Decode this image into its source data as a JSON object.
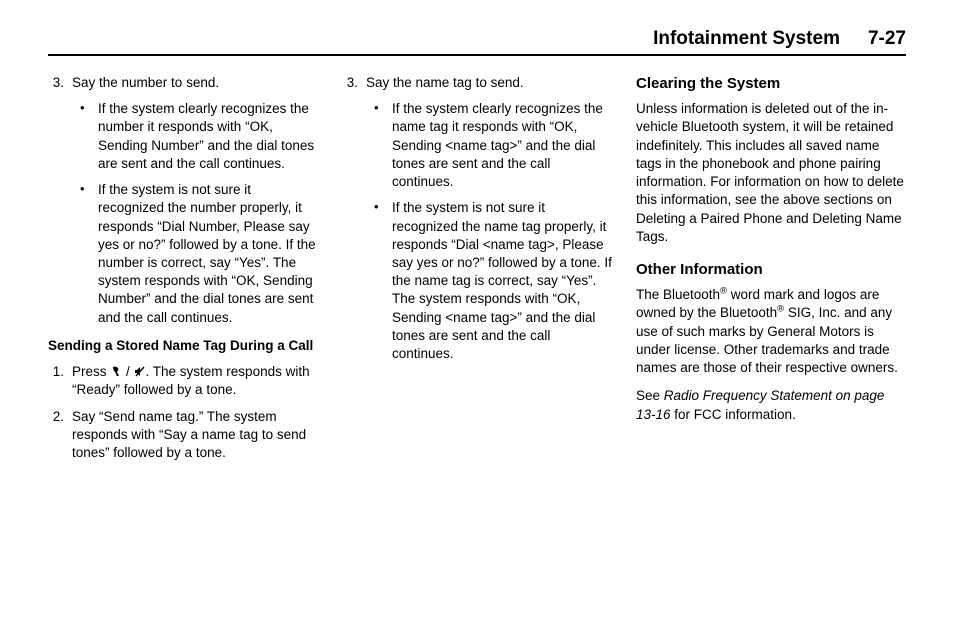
{
  "header": {
    "title": "Infotainment System",
    "page": "7-27"
  },
  "col1": {
    "item3_num": "3.",
    "item3_text": "Say the number to send.",
    "b1": "If the system clearly recognizes the number it responds with “OK, Sending Number” and the dial tones are sent and the call continues.",
    "b2": "If the system is not sure it recognized the number properly, it responds “Dial Number, Please say yes or no?” followed by a tone. If the number is correct, say “Yes”. The system responds with “OK, Sending Number” and the dial tones are sent and the call continues.",
    "subhead": "Sending a Stored Name Tag During a Call",
    "s1_num": "1.",
    "s1_pre": "Press ",
    "s1_post": ". The system responds with “Ready” followed by a tone.",
    "s2_num": "2.",
    "s2_text": "Say “Send name tag.” The system responds with “Say a name tag to send tones” followed by a tone."
  },
  "col2": {
    "item3_num": "3.",
    "item3_text": "Say the name tag to send.",
    "b1": "If the system clearly recognizes the name tag it responds with “OK, Sending <name tag>” and the dial tones are sent and the call continues.",
    "b2": "If the system is not sure it recognized the name tag properly, it responds “Dial <name tag>, Please say yes or no?” followed by a tone. If the name tag is correct, say “Yes”. The system responds with “OK, Sending <name tag>” and the dial tones are sent and the call continues."
  },
  "col3": {
    "h1": "Clearing the System",
    "p1": "Unless information is deleted out of the in-vehicle Bluetooth system, it will be retained indefinitely. This includes all saved name tags in the phonebook and phone pairing information. For information on how to delete this information, see the above sections on Deleting a Paired Phone and Deleting Name Tags.",
    "h2": "Other Information",
    "p2a": "The Bluetooth",
    "p2b": " word mark and logos are owned by the Bluetooth",
    "p2c": " SIG, Inc. and any use of such marks by General Motors is under license. Other trademarks and trade names are those of their respective owners.",
    "p3a": "See ",
    "p3b": "Radio Frequency Statement on page 13-16",
    "p3c": " for FCC information."
  }
}
